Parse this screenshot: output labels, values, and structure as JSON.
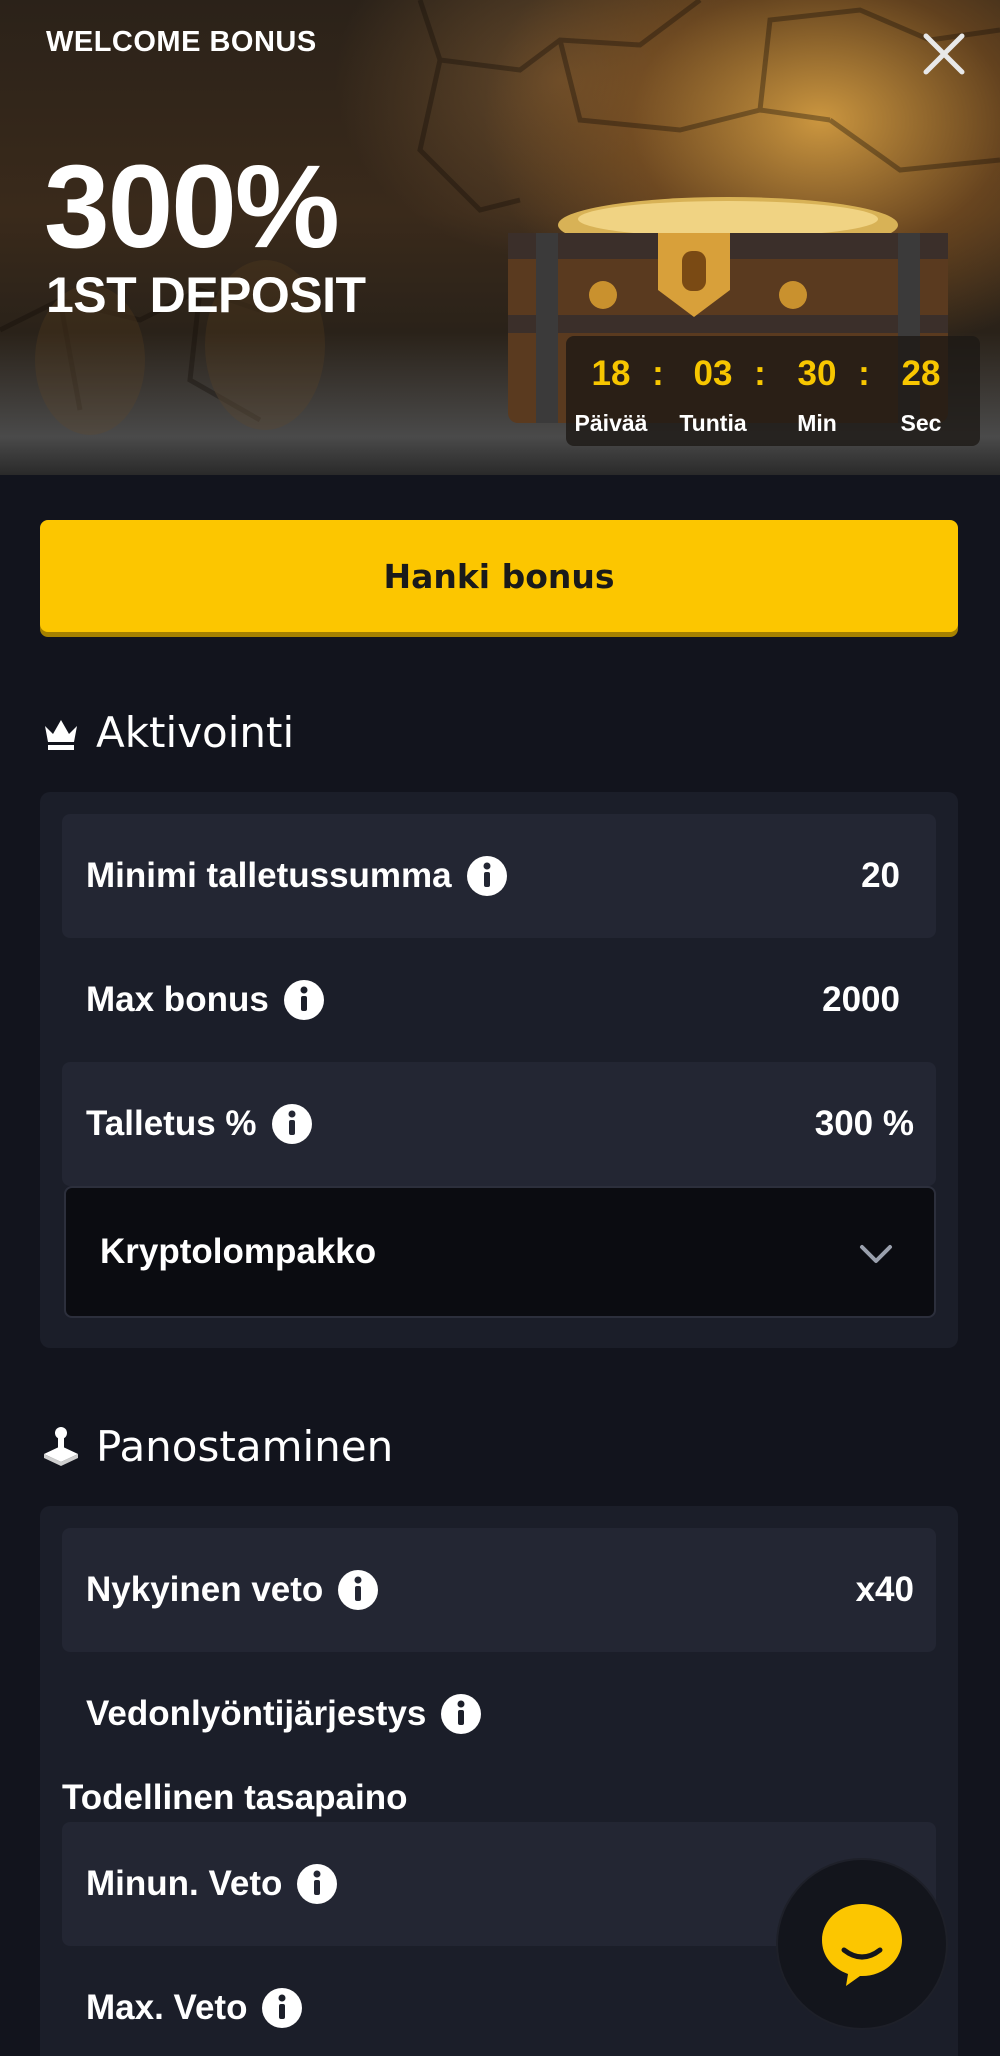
{
  "hero": {
    "badge": "WELCOME BONUS",
    "headline": "300%",
    "subheadline": "1ST DEPOSIT",
    "timer": {
      "days": "18",
      "hours": "03",
      "minutes": "30",
      "seconds": "28",
      "separator": ":",
      "days_label": "Päivää",
      "hours_label": "Tuntia",
      "minutes_label": "Min",
      "seconds_label": "Sec"
    }
  },
  "cta": {
    "label": "Hanki bonus"
  },
  "activation": {
    "title": "Aktivointi",
    "rows": [
      {
        "label": "Minimi talletussumma",
        "value": "20"
      },
      {
        "label": "Max bonus",
        "value": "2000"
      },
      {
        "label": "Talletus %",
        "value": "300 %"
      }
    ],
    "payment_select": {
      "selected": "Kryptolompakko"
    }
  },
  "wagering": {
    "title": "Panostaminen",
    "rows": [
      {
        "label": "Nykyinen veto",
        "value": "x40"
      },
      {
        "label": "Vedonlyöntijärjestys",
        "value": ""
      }
    ],
    "balance_heading": "Todellinen tasapaino",
    "bet_rows": [
      {
        "label": "Minun. Veto",
        "value": ""
      },
      {
        "label": "Max. Veto",
        "value": ""
      }
    ]
  },
  "colors": {
    "accent": "#fcc600",
    "background": "#12141d",
    "panel": "#1b1e29",
    "row": "#232633"
  },
  "icons": {
    "close": "close-icon",
    "activation": "crown-icon",
    "wagering": "wager-icon",
    "info": "info-icon",
    "chevron": "chevron-down-icon",
    "chat": "chat-icon"
  }
}
